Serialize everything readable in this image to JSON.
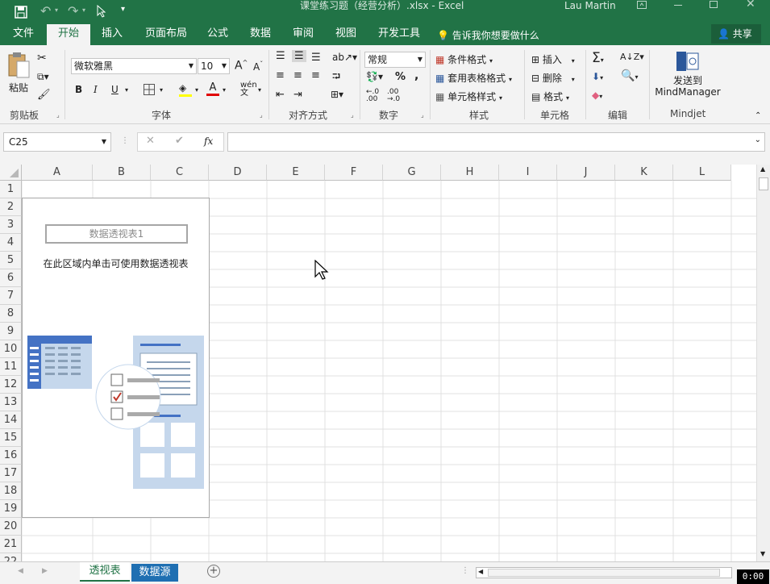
{
  "window": {
    "title": "课堂练习题（经营分析）.xlsx  -  Excel",
    "user": "Lau Martin"
  },
  "tabs": [
    "文件",
    "开始",
    "插入",
    "页面布局",
    "公式",
    "数据",
    "审阅",
    "视图",
    "开发工具"
  ],
  "tell_me": "告诉我你想要做什么",
  "share": "共享",
  "ribbon": {
    "clipboard": {
      "paste": "粘贴",
      "label": "剪贴板"
    },
    "font": {
      "name": "微软雅黑",
      "size": "10",
      "bold": "B",
      "italic": "I",
      "underline": "U",
      "label": "字体",
      "grow": "A",
      "shrink": "A",
      "font_color": "A"
    },
    "alignment": {
      "label": "对齐方式"
    },
    "number": {
      "format": "常规",
      "percent": "%",
      "comma": ",",
      "label": "数字"
    },
    "styles": {
      "conditional": "条件格式",
      "table": "套用表格格式",
      "cell": "单元格样式",
      "label": "样式"
    },
    "cells": {
      "insert": "插入",
      "delete": "删除",
      "format": "格式",
      "label": "单元格"
    },
    "editing": {
      "label": "编辑"
    },
    "mindjet": {
      "send": "发送到",
      "app": "MindManager",
      "label": "Mindjet"
    }
  },
  "formula_bar": {
    "name_box": "C25",
    "fx": "fx",
    "value": ""
  },
  "columns": [
    "A",
    "B",
    "C",
    "D",
    "E",
    "F",
    "G",
    "H",
    "I",
    "J",
    "K",
    "L"
  ],
  "rows": [
    "1",
    "2",
    "3",
    "4",
    "5",
    "6",
    "7",
    "8",
    "9",
    "10",
    "11",
    "12",
    "13",
    "14",
    "15",
    "16",
    "17",
    "18",
    "19",
    "20",
    "21",
    "22"
  ],
  "pivot": {
    "name": "数据透视表1",
    "hint": "在此区域内单击可使用数据透视表"
  },
  "sheets": [
    {
      "name": "透视表",
      "active": true
    },
    {
      "name": "数据源",
      "active": false
    }
  ],
  "clock": "0:00",
  "colors": {
    "excel_green": "#217346",
    "pivot_blue": "#4472c4",
    "pivot_light": "#c5d7ec",
    "check_red": "#c0392b"
  }
}
